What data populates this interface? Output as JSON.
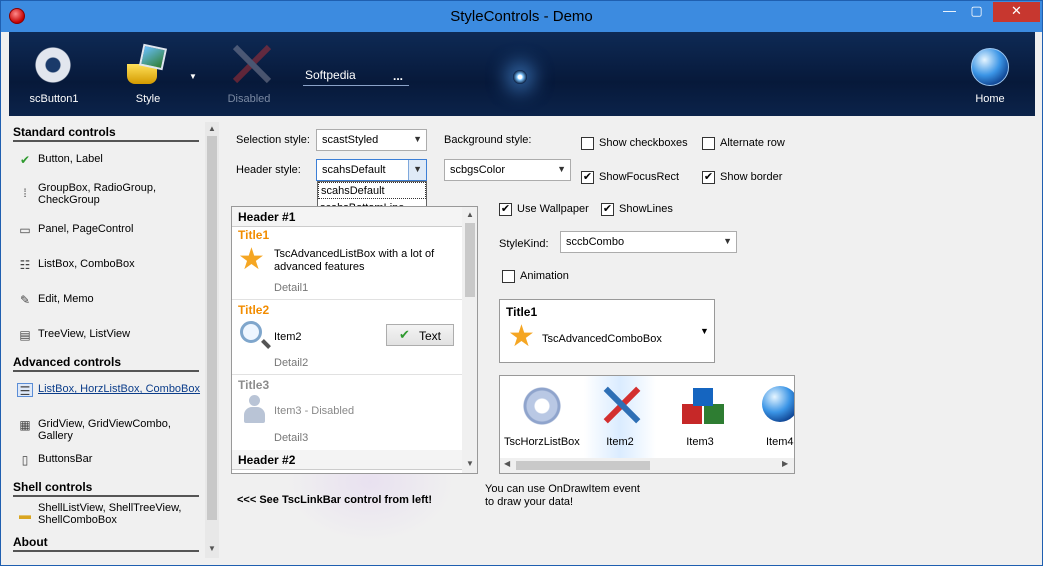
{
  "window": {
    "title": "StyleControls - Demo",
    "min": "—",
    "max": "▢",
    "close": "✕"
  },
  "toolbar": {
    "button1": "scButton1",
    "style": "Style",
    "disabled": "Disabled",
    "input_value": "Softpedia",
    "input_dots": "...",
    "home": "Home"
  },
  "sidebar": {
    "sections": [
      {
        "title": "Standard controls"
      },
      {
        "title": "Advanced controls"
      },
      {
        "title": "Shell controls"
      },
      {
        "title": "About"
      }
    ],
    "items": [
      {
        "label": "Button, Label",
        "icon": "✔"
      },
      {
        "label": "GroupBox, RadioGroup, CheckGroup",
        "icon": "⁞"
      },
      {
        "label": "Panel, PageControl",
        "icon": "▭"
      },
      {
        "label": "ListBox, ComboBox",
        "icon": "☷"
      },
      {
        "label": "Edit, Memo",
        "icon": "✎"
      },
      {
        "label": "TreeView, ListView",
        "icon": "▤"
      },
      {
        "label": "ListBox, HorzListBox, ComboBox",
        "icon": "☰"
      },
      {
        "label": "GridView, GridViewCombo, Gallery",
        "icon": "▦"
      },
      {
        "label": "ButtonsBar",
        "icon": "▯"
      },
      {
        "label": "ShellListView, ShellTreeView, ShellComboBox",
        "icon": "▬"
      }
    ]
  },
  "settings": {
    "selection_style_label": "Selection style:",
    "selection_style_value": "scastStyled",
    "header_style_label": "Header style:",
    "header_style_value": "scahsDefault",
    "header_style_options": [
      "scahsDefault",
      "scahsBottomLine"
    ],
    "background_style_label": "Background style:",
    "background_style_value": "scbgsColor",
    "show_checkboxes": "Show checkboxes",
    "alternate_row": "Alternate row",
    "show_focus_rect": "ShowFocusRect",
    "show_border": "Show border",
    "use_wallpaper": "Use Wallpaper",
    "show_lines": "ShowLines",
    "style_kind_label": "StyleKind:",
    "style_kind_value": "sccbCombo",
    "animation": "Animation",
    "check_mark": "✔"
  },
  "listbox": {
    "header1": "Header #1",
    "header2": "Header #2",
    "items": [
      {
        "title": "Title1",
        "text": "TscAdvancedListBox with a lot of advanced features",
        "detail": "Detail1"
      },
      {
        "title": "Title2",
        "text": "Item2",
        "detail": "Detail2",
        "button": "Text"
      },
      {
        "title": "Title3",
        "text": "Item3 - Disabled",
        "detail": "Detail3"
      }
    ]
  },
  "combo_panel": {
    "title": "Title1",
    "text": "TscAdvancedComboBox"
  },
  "horz_list": {
    "items": [
      "TscHorzListBox",
      "Item2",
      "Item3",
      "Item4"
    ]
  },
  "notes": {
    "left": "<<< See TscLinkBar control from left!",
    "right": "You can use OnDrawItem event to draw your data!"
  },
  "colors": {
    "title_orange": "#f28c00",
    "toolbar_bg": "#0b234a",
    "link_blue": "#0b3d8a"
  }
}
